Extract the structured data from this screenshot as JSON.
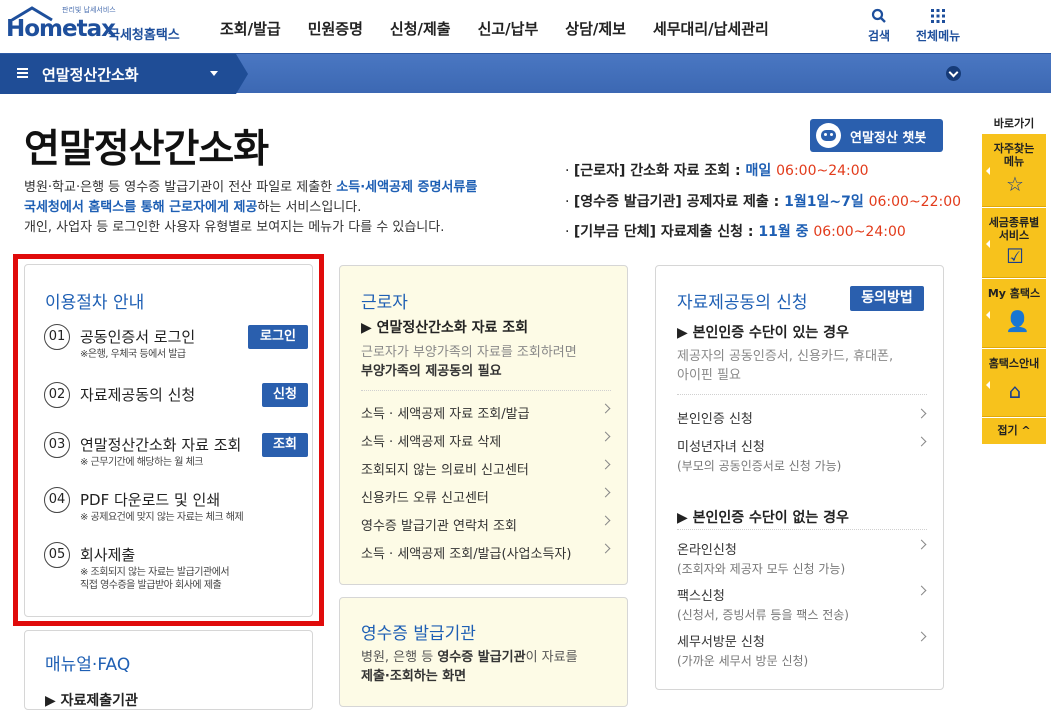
{
  "header": {
    "logo_text": "Hometax",
    "logo_sub": "판리빛 납세서비스",
    "logo_kr": "국세청홈택스",
    "gnb": [
      "조회/발급",
      "민원증명",
      "신청/제출",
      "신고/납부",
      "상담/제보",
      "세무대리/납세관리"
    ],
    "search_label": "검색",
    "all_menu_label": "전체메뉴"
  },
  "navbar": {
    "title": "연말정산간소화"
  },
  "page": {
    "title": "연말정산간소화",
    "intro": {
      "p1": "병원·학교·은행 등 영수증 발급기관이 전산 파일로 제출한 ",
      "p1_hl": "소득·세액공제 증명서류를",
      "p2_hl": "국세청에서 홈택스를 통해 근로자에게 제공",
      "p2": "하는 서비스입니다.",
      "p3": "개인, 사업자 등 로그인한 사용자 유형별로 보여지는 메뉴가 다를 수 있습니다."
    },
    "chatbot_label": "연말정산 챗봇",
    "schedule": [
      {
        "bullet": "·",
        "label": "[근로자] 간소화 자료 조회 : ",
        "date": "매일 ",
        "time": "06:00~24:00"
      },
      {
        "bullet": "·",
        "label": "[영수증 발급기관] 공제자료 제출 : ",
        "date": "1월1일~7일 ",
        "time": "06:00~22:00"
      },
      {
        "bullet": "·",
        "label": "[기부금 단체] 자료제출 신청 : ",
        "date": "11월 중 ",
        "time": "06:00~24:00"
      }
    ]
  },
  "procedure": {
    "title": "이용절차 안내",
    "steps": [
      {
        "num": "01",
        "title": "공동인증서 로그인",
        "note": "※은행, 우체국 등에서 발급",
        "btn": "로그인"
      },
      {
        "num": "02",
        "title": "자료제공동의 신청",
        "note": "",
        "btn": "신청"
      },
      {
        "num": "03",
        "title": "연말정산간소화 자료 조회",
        "note": "※ 근무기간에 해당하는 월 체크",
        "btn": "조회"
      },
      {
        "num": "04",
        "title": "PDF 다운로드 및 인쇄",
        "note": "※ 공제요건에 맞지 않는 자료는 체크 해제",
        "btn": ""
      },
      {
        "num": "05",
        "title": "회사제출",
        "note": "※ 조회되지 않는 자료는 발급기관에서",
        "note2": "직접 영수증을 발급받아 회사에 제출",
        "btn": ""
      }
    ]
  },
  "manual": {
    "title": "매뉴얼·FAQ",
    "first_item": "▶ 자료제출기관"
  },
  "worker": {
    "title": "근로자",
    "sub_head": "▶ 연말정산간소화 자료 조회",
    "desc1": "근로자가 부양가족의 자료를 조회하려면",
    "desc2": "부양가족의 제공동의 필요",
    "links": [
      "소득 · 세액공제 자료 조회/발급",
      "소득 · 세액공제 자료 삭제",
      "조회되지 않는 의료비 신고센터",
      "신용카드 오류 신고센터",
      "영수증 발급기관 연락처 조회",
      "소득 · 세액공제 조회/발급(사업소득자)"
    ]
  },
  "issuer": {
    "title": "영수증 발급기관",
    "desc1": "병원, 은행 등 ",
    "desc1_b": "영수증 발급기관",
    "desc1_c": "이 자료를",
    "desc2_b": "제출·조회",
    "desc2_c": "하는 화면"
  },
  "consent": {
    "title": "자료제공동의 신청",
    "btn": "동의방법",
    "head1": "▶ 본인인증 수단이 있는 경우",
    "desc1": "제공자의 공동인증서, 신용카드, 휴대폰,",
    "desc2": "아이핀 필요",
    "links1": [
      {
        "label": "본인인증 신청",
        "sub": ""
      },
      {
        "label": "미성년자녀 신청",
        "sub": "(부모의 공동인증서로 신청 가능)"
      }
    ],
    "head2": "▶ 본인인증 수단이 없는 경우",
    "links2": [
      {
        "label": "온라인신청",
        "sub": "(조회자와 제공자 모두 신청 가능)"
      },
      {
        "label": "팩스신청",
        "sub": "(신청서, 증빙서류 등을 팩스 전송)"
      },
      {
        "label": "세무서방문 신청",
        "sub": "(가까운 세무서 방문 신청)"
      }
    ]
  },
  "quick": {
    "title": "바로가기",
    "items": [
      {
        "l1": "자주찾는",
        "l2": "메뉴",
        "icon": "☆",
        "icon_name": "star-icon"
      },
      {
        "l1": "세금종류별",
        "l2": "서비스",
        "icon": "☑",
        "icon_name": "checkbox-icon"
      },
      {
        "l1": "My 홈택스",
        "l2": "",
        "icon": "👤",
        "icon_name": "user-icon"
      },
      {
        "l1": "홈택스안내",
        "l2": "",
        "icon": "⌂",
        "icon_name": "home-icon"
      }
    ],
    "close": "접기 ^"
  },
  "colors": {
    "brand_blue": "#2a5fae",
    "nav_blue": "#4a77c2",
    "highlight_frame": "#e00b0b",
    "quick_yellow": "#f7c21c",
    "time_red": "#e23b1b"
  }
}
